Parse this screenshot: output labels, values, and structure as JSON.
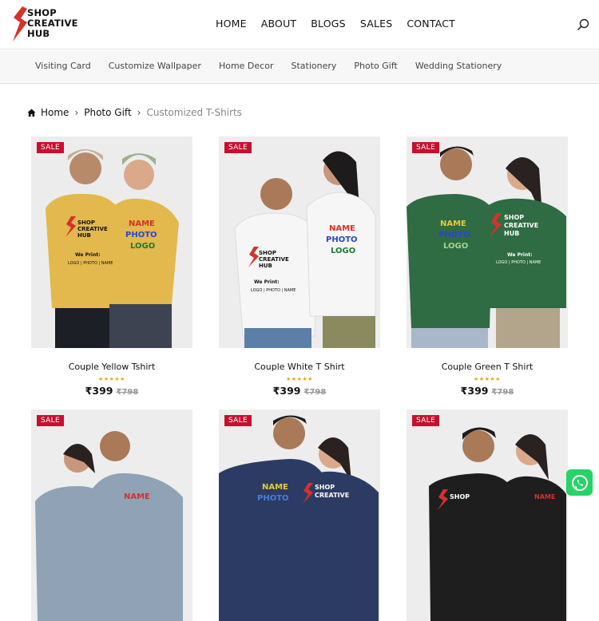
{
  "brand": {
    "line1": "SHOP",
    "line2": "CREATIVE",
    "line3": "HUB"
  },
  "nav": [
    "HOME",
    "ABOUT",
    "BLOGS",
    "SALES",
    "CONTACT"
  ],
  "subnav": [
    "Visiting Card",
    "Customize Wallpaper",
    "Home Decor",
    "Stationery",
    "Photo Gift",
    "Wedding Stationery"
  ],
  "breadcrumb": {
    "home": "Home",
    "sep": "›",
    "parent": "Photo Gift",
    "current": "Customized T-Shirts"
  },
  "sale_badge": "SALE",
  "products": [
    {
      "title": "Couple Yellow Tshirt",
      "stars": "★★★★★",
      "price": "₹399",
      "old_price": "₹798",
      "shirt": "#e3b84d"
    },
    {
      "title": "Couple White T Shirt",
      "stars": "★★★★★",
      "price": "₹399",
      "old_price": "₹798",
      "shirt": "#f4f4f4"
    },
    {
      "title": "Couple Green T Shirt",
      "stars": "★★★★★",
      "price": "₹399",
      "old_price": "₹798",
      "shirt": "#2f6b43"
    },
    {
      "title": "",
      "stars": "",
      "price": "",
      "old_price": "",
      "shirt": "#8fa2b6"
    },
    {
      "title": "",
      "stars": "",
      "price": "",
      "old_price": "",
      "shirt": "#2c3b63"
    },
    {
      "title": "",
      "stars": "",
      "price": "",
      "old_price": "",
      "shirt": "#1e1e1e"
    }
  ],
  "print_text": {
    "name": "NAME",
    "photo": "PHOTO",
    "logo": "LOGO",
    "we_print": "We Print:",
    "items": "LOGO | PHOTO | NAME"
  },
  "colors": {
    "accent": "#c8102e",
    "whatsapp": "#25d366",
    "stars": "#e4a712"
  }
}
